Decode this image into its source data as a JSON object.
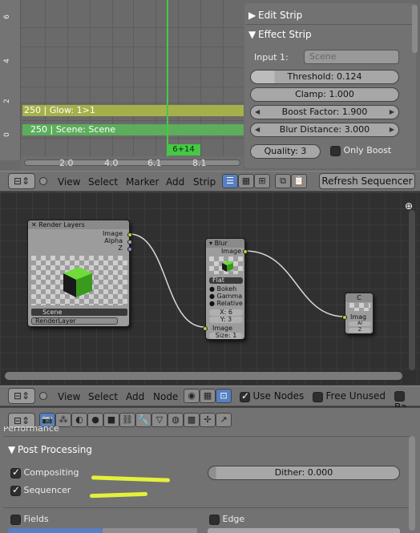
{
  "sequencer": {
    "y_ticks": [
      "0",
      "2",
      "4",
      "6"
    ],
    "x_ticks": [
      "2.0",
      "4.0",
      "6.1",
      "8.1"
    ],
    "strips": [
      {
        "label": "250 | Glow: 1>1",
        "color": "#a6b04a"
      },
      {
        "label": "250 | Scene: Scene",
        "color": "#5cae5c"
      }
    ],
    "current_frame": "6+14",
    "cursor_color": "#45c845"
  },
  "strip_props": {
    "edit_strip": "Edit Strip",
    "effect_strip": "Effect Strip",
    "input_label": "Input 1:",
    "input_placeholder": "Scene",
    "threshold": "Threshold: 0.124",
    "clamp": "Clamp: 1.000",
    "boost_factor": "Boost Factor: 1.900",
    "blur_distance": "Blur Distance: 3.000",
    "quality": "Quality: 3",
    "only_boost": "Only Boost"
  },
  "seq_header": {
    "menus": [
      "View",
      "Select",
      "Marker",
      "Add",
      "Strip"
    ],
    "refresh_button": "Refresh Sequencer"
  },
  "node_editor": {
    "render_layers": {
      "title": "Render Layers",
      "outputs": [
        "Image",
        "Alpha",
        "Z"
      ],
      "scene": "Scene",
      "layer": "RenderLayer"
    },
    "blur": {
      "title": "Blur",
      "output": "Image",
      "filter": "Flat",
      "options": [
        "Bokeh",
        "Gamma",
        "Relative"
      ],
      "x": "X: 6",
      "y": "Y: 3",
      "input": "Image",
      "size": "Size: 1"
    },
    "composite": {
      "title": "C",
      "input": "Imag",
      "alpha": "Al",
      "z": "Z"
    }
  },
  "node_header": {
    "menus": [
      "View",
      "Select",
      "Add",
      "Node"
    ],
    "use_nodes": "Use Nodes",
    "free_unused": "Free Unused",
    "backdrop_partial": "Ba"
  },
  "render_props": {
    "performance_partial": "Performance",
    "post_processing": "Post Processing",
    "compositing": "Compositing",
    "sequencer": "Sequencer",
    "dither": "Dither: 0.000",
    "fields": "Fields",
    "edge": "Edge",
    "highlight_color": "#e5f03a"
  }
}
